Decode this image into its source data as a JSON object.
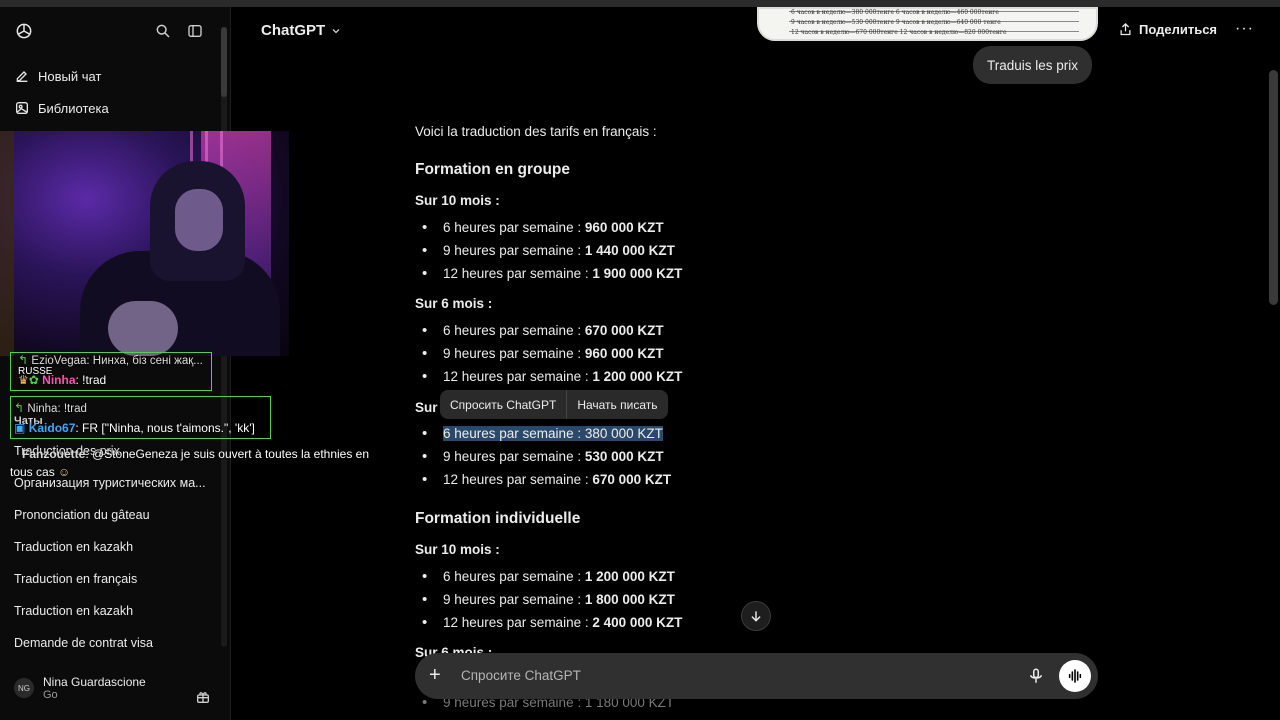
{
  "sidebar": {
    "new_chat": "Новый чат",
    "library": "Библиотека",
    "section_chats": "Чаты",
    "chats": [
      "Traduction des prix",
      "Организация туристических ма...",
      "Prononciation du gâteau",
      "Traduction en kazakh",
      "Traduction en français",
      "Traduction en kazakh",
      "Demande de contrat visa"
    ],
    "user": {
      "initials": "NG",
      "name": "Nina Guardascione",
      "plan": "Go"
    }
  },
  "header": {
    "model": "ChatGPT",
    "share": "Поделиться",
    "more": "···"
  },
  "image_preview_lines": [
    "6 часов в неделю—380 000тенге   6 часов в неделю—460 000тенге",
    "9 часов в неделю—530 000тенге   9 часов в неделю—640 000 тенге",
    "12 часов в неделю—670 000тенге  12 часов в неделю—820 000тенге"
  ],
  "user_message": "Traduis les prix",
  "assistant": {
    "intro": "Voici la traduction des tarifs en français :",
    "group_heading": "Formation en groupe",
    "group_10_label": "Sur 10 mois :",
    "group_10": [
      {
        "label": "6 heures par semaine : ",
        "price": "960 000 KZT"
      },
      {
        "label": "9 heures par semaine : ",
        "price": "1 440 000 KZT"
      },
      {
        "label": "12 heures par semaine : ",
        "price": "1 900 000 KZT"
      }
    ],
    "group_6_label": "Sur 6 mois :",
    "group_6": [
      {
        "label": "6 heures par semaine : ",
        "price": "670 000 KZT"
      },
      {
        "label": "9 heures par semaine : ",
        "price": "960 000 KZT"
      },
      {
        "label": "12 heures par semaine : ",
        "price": "1 200 000 KZT"
      }
    ],
    "group_3_label": "Sur",
    "group_3": [
      {
        "label": "6 heures par semaine : ",
        "price": "380 000 KZT"
      },
      {
        "label": "9 heures par semaine : ",
        "price": "530 000 KZT"
      },
      {
        "label": "12 heures par semaine : ",
        "price": "670 000 KZT"
      }
    ],
    "indiv_heading": "Formation individuelle",
    "indiv_10_label": "Sur 10 mois :",
    "indiv_10": [
      {
        "label": "6 heures par semaine : ",
        "price": "1 200 000 KZT"
      },
      {
        "label": "9 heures par semaine : ",
        "price": "1 800 000 KZT"
      },
      {
        "label": "12 heures par semaine : ",
        "price": "2 400 000 KZT"
      }
    ],
    "indiv_6_label": "Sur 6 mois :",
    "indiv_6_first": "9 heures par semaine : 1 180 000 KZT"
  },
  "selection_popup": {
    "ask": "Спросить ChatGPT",
    "write": "Начать писать"
  },
  "composer": {
    "placeholder": "Спросите ChatGPT"
  },
  "stream_chat": [
    {
      "reply": "EzioVegaa: Нинха, біз сені жақ...",
      "nick": "Ninha",
      "msg": ": !trad",
      "badge": "RUSSE"
    },
    {
      "reply": "Ninha: !trad",
      "nick": "Kaido67",
      "msg": ": FR [\"Ninha, nous t'aimons.\", 'kk']"
    },
    {
      "nick": "Fanzouette",
      "msg": ": @StoneGeneza je suis ouvert à toutes la ethnies en",
      "msg2": "tous cas"
    }
  ],
  "colors": {
    "accent_green": "#4fd14f",
    "highlight": "#2b4a6b",
    "nick_pink": "#ff4fb0",
    "nick_blue": "#3fa7ff"
  }
}
